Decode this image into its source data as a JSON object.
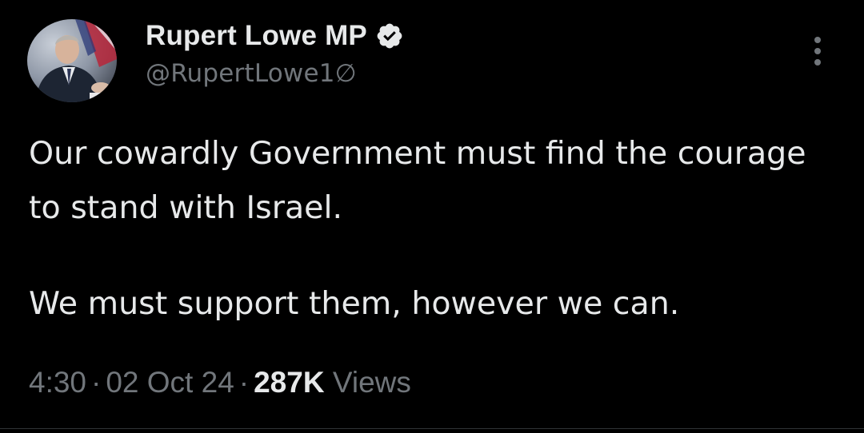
{
  "author": {
    "display_name": "Rupert Lowe MP",
    "handle": "@RupertLowe1∅",
    "verified": true,
    "verified_badge_color": "#e7e9ea"
  },
  "tweet": {
    "paragraphs": [
      "Our cowardly Government must find the courage to stand with Israel.",
      "We must support them, however we can."
    ]
  },
  "meta": {
    "time": "4:30",
    "separator": "·",
    "date": "02 Oct 24",
    "views_count": "287K",
    "views_label": "Views"
  },
  "icons": {
    "more": "more-vertical-icon",
    "verified": "verified-badge-icon"
  },
  "colors": {
    "background": "#000000",
    "primary_text": "#e7e9ea",
    "secondary_text": "#71767b"
  }
}
